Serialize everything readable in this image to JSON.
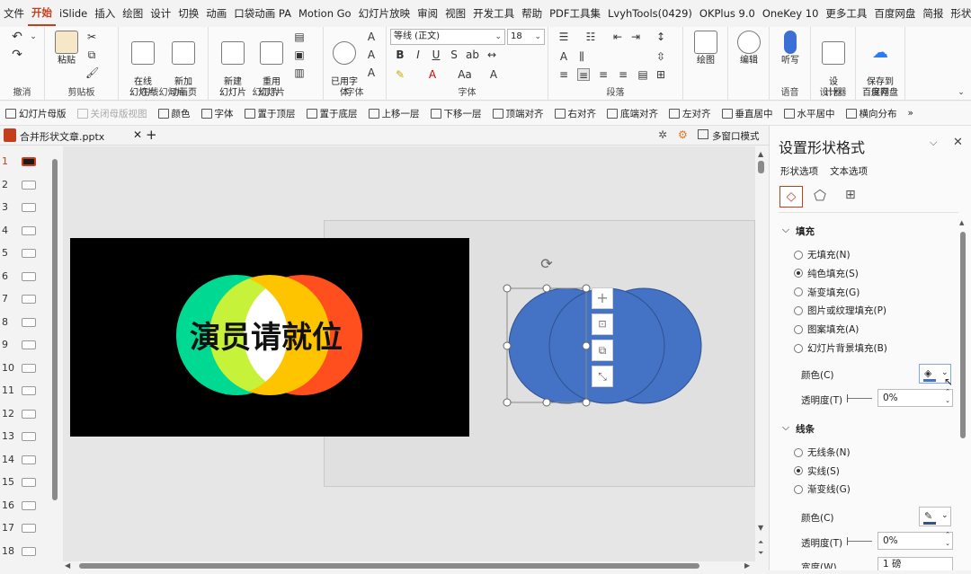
{
  "menu": [
    "文件",
    "开始",
    "iSlide",
    "插入",
    "绘图",
    "设计",
    "切换",
    "动画",
    "口袋动画 PA",
    "Motion Go",
    "幻灯片放映",
    "审阅",
    "视图",
    "开发工具",
    "帮助",
    "PDF工具集",
    "LvyhTools(0429)",
    "OKPlus 9.0",
    "OneKey 10",
    "更多工具",
    "百度网盘",
    "简报",
    "形状"
  ],
  "menu_active_index": 1,
  "ribbon": {
    "undo_group": "撤消",
    "clipboard": {
      "paste": "粘贴",
      "group": "剪贴板"
    },
    "online": {
      "online_slide": "在线\n幻灯片",
      "new_anim": "新加\n动画页",
      "group": "在线幻灯片"
    },
    "slides": {
      "new_slide": "新建\n幻灯片",
      "reuse": "重用\n幻灯片",
      "group": "幻灯片"
    },
    "font": {
      "font_name": "等线 (正文)",
      "font_size": "18",
      "pinyin": "已用字\n体",
      "group": "字体",
      "group2": "字体"
    },
    "paragraph": {
      "group": "段落"
    },
    "draw": {
      "label": "绘图"
    },
    "edit": {
      "label": "编辑"
    },
    "voice": {
      "dictate": "听写",
      "group": "语音"
    },
    "designer": {
      "label": "设\n计器",
      "group": "设计器"
    },
    "save": {
      "label": "保存到\n百度网盘",
      "group": "保存"
    }
  },
  "toolbar2": [
    {
      "label": "幻灯片母版",
      "disabled": false
    },
    {
      "label": "关闭母版视图",
      "disabled": true
    },
    {
      "label": "颜色",
      "disabled": false
    },
    {
      "label": "字体",
      "disabled": false
    },
    {
      "label": "置于顶层",
      "disabled": false
    },
    {
      "label": "置于底层",
      "disabled": false
    },
    {
      "label": "上移一层",
      "disabled": false
    },
    {
      "label": "下移一层",
      "disabled": false
    },
    {
      "label": "顶端对齐",
      "disabled": false
    },
    {
      "label": "右对齐",
      "disabled": false
    },
    {
      "label": "底端对齐",
      "disabled": false
    },
    {
      "label": "左对齐",
      "disabled": false
    },
    {
      "label": "垂直居中",
      "disabled": false
    },
    {
      "label": "水平居中",
      "disabled": false
    },
    {
      "label": "横向分布",
      "disabled": false
    },
    {
      "label": "»",
      "disabled": false
    }
  ],
  "doc": {
    "filename": "合并形状文章.pptx",
    "multiwindow": "多窗口模式"
  },
  "thumbs": [
    "1",
    "2",
    "3",
    "4",
    "5",
    "6",
    "7",
    "8",
    "9",
    "10",
    "11",
    "12",
    "13",
    "14",
    "15",
    "16",
    "17",
    "18"
  ],
  "slide": {
    "text": "演员请就位"
  },
  "pane": {
    "title": "设置形状格式",
    "tab_shape": "形状选项",
    "tab_text": "文本选项",
    "fill_header": "填充",
    "fill_options": [
      "无填充(N)",
      "纯色填充(S)",
      "渐变填充(G)",
      "图片或纹理填充(P)",
      "图案填充(A)",
      "幻灯片背景填充(B)"
    ],
    "fill_selected": 1,
    "color_label": "颜色(C)",
    "transparency_label": "透明度(T)",
    "transparency_value": "0%",
    "line_header": "线条",
    "line_options": [
      "无线条(N)",
      "实线(S)",
      "渐变线(G)"
    ],
    "line_selected": 1,
    "line_color_label": "颜色(C)",
    "line_transparency_label": "透明度(T)",
    "line_transparency_value": "0%",
    "width_label": "宽度(W)",
    "width_value": "1 磅"
  },
  "colors": {
    "accent": "#c43e1c",
    "shape_blue": "#4472c4",
    "green": "#00d992",
    "yellow_green": "#c7f23a",
    "yellow": "#ffc400",
    "orange_red": "#ff4f1f"
  }
}
